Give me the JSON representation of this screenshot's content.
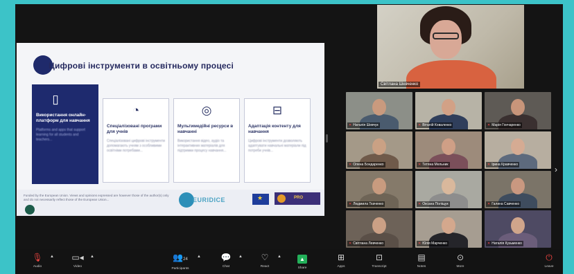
{
  "slide": {
    "title": "Цифрові інструменти в освітньому процесі",
    "cards": [
      {
        "icon": "tablet-icon",
        "title": "Використання онлайн-платформ для навчання",
        "text": "Platforms and apps that support learning for all students and teachers..."
      },
      {
        "icon": "pie-chart-icon",
        "title": "Спеціалізовані програми для учнів",
        "text": "Спеціалізовані цифрові інструменти допомагають учням з особливими освітніми потребами..."
      },
      {
        "icon": "target-icon",
        "title": "Мультимедійні ресурси в навчанні",
        "text": "Використання відео, аудіо та інтерактивних матеріалів для підтримки процесу навчання..."
      },
      {
        "icon": "content-icon",
        "title": "Адаптація контенту для навчання",
        "text": "Цифрові інструменти дозволяють адаптувати навчальні матеріали під потреби учнів..."
      }
    ],
    "footer_text": "Funded by the European Union. Views and opinions expressed are however those of the author(s) only and do not necessarily reflect those of the European Union...",
    "logo_text": "EURIDICE",
    "partner_logo_text": "PRO"
  },
  "speaker": {
    "name": "Світлана Шевченко"
  },
  "participants": [
    {
      "name": "Наталія Шевчук",
      "head": "#c99a7e",
      "body": "#4a5b6e",
      "bg": "#8c8f88"
    },
    {
      "name": "Віталій Коваленко",
      "head": "#d2a186",
      "body": "#2f3e5b",
      "bg": "#b7b3a6"
    },
    {
      "name": "Марія Гончаренко",
      "head": "#c8957a",
      "body": "#3a3030",
      "bg": "#5e5a55"
    },
    {
      "name": "Олена Бондаренко",
      "head": "#caa184",
      "body": "#6f5a4a",
      "bg": "#a49988"
    },
    {
      "name": "Тетяна Мельник",
      "head": "#cf9f86",
      "body": "#7b4f5a",
      "bg": "#9d8b7b"
    },
    {
      "name": "Ірина Кравченко",
      "head": "#d5ab93",
      "body": "#5d6a7d",
      "bg": "#b7aea0"
    },
    {
      "name": "Людмила Ткаченко",
      "head": "#c89b7f",
      "body": "#6e6456",
      "bg": "#857a6a"
    },
    {
      "name": "Оксана Поліщук",
      "head": "#d9b89c",
      "body": "#8d8d8d",
      "bg": "#a9a9a1"
    },
    {
      "name": "Галина Савченко",
      "head": "#c99880",
      "body": "#3e4c5e",
      "bg": "#7b7468"
    },
    {
      "name": "Світлана Левченко",
      "head": "#cba085",
      "body": "#5a4f47",
      "bg": "#6d6258"
    },
    {
      "name": "Юлія Марченко",
      "head": "#d4a88d",
      "body": "#25252a",
      "bg": "#a69d91"
    },
    {
      "name": "Наталія Кузьменко",
      "head": "#d0a58b",
      "body": "#6b5d7a",
      "bg": "#4e4a63"
    }
  ],
  "toolbar": {
    "audio": "Audio",
    "video": "Video",
    "participants": "Participants",
    "participants_count": "24",
    "chat": "Chat",
    "react": "React",
    "share": "Share",
    "apps": "Apps",
    "transcript": "Transcript",
    "notes": "Notes",
    "more": "More",
    "leave": "Leave"
  }
}
